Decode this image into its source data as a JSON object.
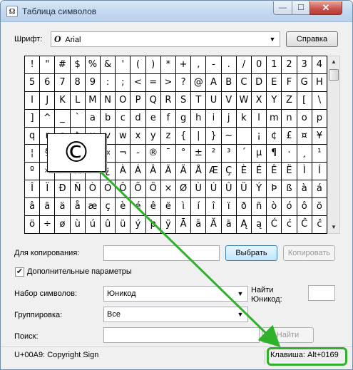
{
  "window": {
    "title": "Таблица символов",
    "controls": {
      "minimize": "—",
      "maximize": "☐",
      "close": "✕"
    }
  },
  "font_row": {
    "label": "Шрифт:",
    "font_icon": "opentype-icon",
    "font_value": "Arial",
    "help_button": "Справка"
  },
  "grid": {
    "rows": [
      [
        "!",
        "\"",
        "#",
        "$",
        "%",
        "&",
        "'",
        "(",
        ")",
        "*",
        "+",
        ",",
        "-",
        ".",
        "/",
        "0",
        "1",
        "2",
        "3",
        "4"
      ],
      [
        "5",
        "6",
        "7",
        "8",
        "9",
        ":",
        ";",
        "<",
        "=",
        ">",
        "?",
        "@",
        "A",
        "B",
        "C",
        "D",
        "E",
        "F",
        "G",
        "H"
      ],
      [
        "I",
        "J",
        "K",
        "L",
        "M",
        "N",
        "O",
        "P",
        "Q",
        "R",
        "S",
        "T",
        "U",
        "V",
        "W",
        "X",
        "Y",
        "Z",
        "[",
        "\\"
      ],
      [
        "]",
        "^",
        "_",
        "`",
        "a",
        "b",
        "c",
        "d",
        "e",
        "f",
        "g",
        "h",
        "i",
        "j",
        "k",
        "l",
        "m",
        "n",
        "o",
        "p"
      ],
      [
        "q",
        "r",
        "s",
        "t",
        "u",
        "v",
        "w",
        "x",
        "y",
        "z",
        "{",
        "|",
        "}",
        "~",
        "",
        "¡",
        "¢",
        "£",
        "¤",
        "¥"
      ],
      [
        "¦",
        "§",
        "¨",
        "©",
        "ª",
        "«",
        "¬",
        "-",
        "®",
        "¯",
        "°",
        "±",
        "²",
        "³",
        "´",
        "µ",
        "¶",
        "·",
        "¸",
        "¹"
      ],
      [
        "º",
        "»",
        "¼",
        "½",
        "¾",
        "¿",
        "À",
        "Á",
        "Â",
        "Ã",
        "Ä",
        "Å",
        "Æ",
        "Ç",
        "È",
        "É",
        "Ê",
        "Ë",
        "Ì",
        "Í"
      ],
      [
        "Î",
        "Ï",
        "Ð",
        "Ñ",
        "Ò",
        "Ó",
        "Ô",
        "Õ",
        "Ö",
        "×",
        "Ø",
        "Ù",
        "Ú",
        "Û",
        "Ü",
        "Ý",
        "Þ",
        "ß",
        "à",
        "á"
      ],
      [
        "â",
        "ã",
        "ä",
        "å",
        "æ",
        "ç",
        "è",
        "é",
        "ê",
        "ë",
        "ì",
        "í",
        "î",
        "ï",
        "ð",
        "ñ",
        "ò",
        "ó",
        "ô",
        "õ"
      ],
      [
        "ö",
        "÷",
        "ø",
        "ù",
        "ú",
        "û",
        "ü",
        "ý",
        "þ",
        "ÿ",
        "Ā",
        "ā",
        "Ă",
        "ă",
        "Ą",
        "ą",
        "Ć",
        "ć",
        "Ĉ",
        "ĉ"
      ]
    ],
    "zoomed_char": "©"
  },
  "copy_row": {
    "label": "Для копирования:",
    "value": "",
    "select_button": "Выбрать",
    "copy_button": "Копировать"
  },
  "advanced": {
    "label": "Дополнительные параметры",
    "checked": true
  },
  "charset": {
    "label": "Набор символов:",
    "value": "Юникод",
    "goto_label_line1": "Найти",
    "goto_label_line2": "Юникод:",
    "goto_value": ""
  },
  "grouping": {
    "label": "Группировка:",
    "value": "Все"
  },
  "search": {
    "label": "Поиск:",
    "value": "",
    "button": "Найти"
  },
  "status": {
    "left": "U+00A9: Copyright Sign",
    "right": "Клавиша: Alt+0169"
  },
  "colors": {
    "annotation_green": "#2fb12c",
    "title_bar": "#c4d8ef"
  }
}
